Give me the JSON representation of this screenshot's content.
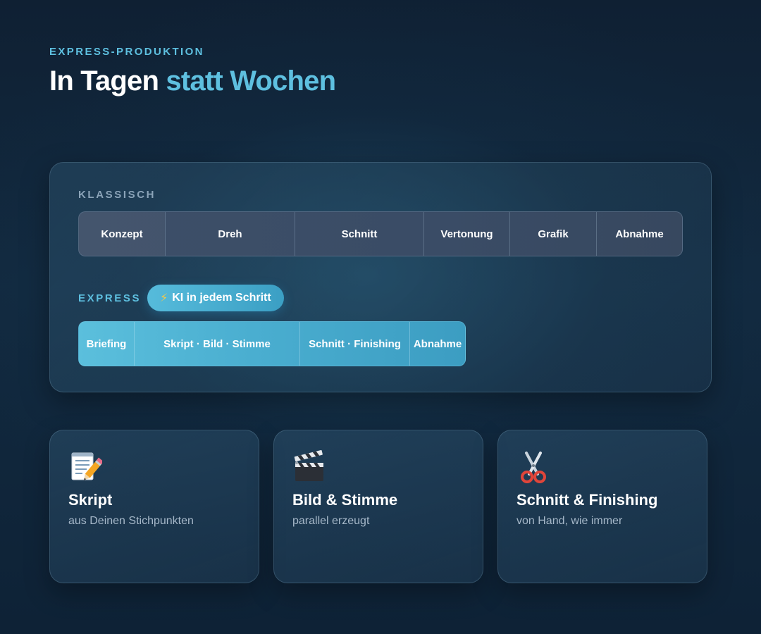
{
  "header": {
    "eyebrow": "EXPRESS-PRODUKTION",
    "title_main": "In Tagen",
    "title_accent": "statt Wochen"
  },
  "timeline": {
    "classic": {
      "label": "KLASSISCH",
      "segments": [
        "Konzept",
        "Dreh",
        "Schnitt",
        "Vertonung",
        "Grafik",
        "Abnahme"
      ]
    },
    "express": {
      "label": "EXPRESS",
      "badge": "KI in jedem Schritt",
      "badge_icon": "lightning-icon",
      "segments": [
        "Briefing",
        "Skript · Bild · Stimme",
        "Schnitt · Finishing",
        "Abnahme"
      ]
    }
  },
  "features": [
    {
      "icon": "memo-pencil-icon",
      "title": "Skript",
      "subtitle": "aus Deinen Stichpunkten"
    },
    {
      "icon": "clapperboard-icon",
      "title": "Bild & Stimme",
      "subtitle": "parallel erzeugt"
    },
    {
      "icon": "scissors-icon",
      "title": "Schnitt & Finishing",
      "subtitle": "von Hand, wie immer"
    }
  ],
  "colors": {
    "accent": "#5ec0e0",
    "background": "#122a40",
    "classic_track": "#3b4d66",
    "express_track": "#4aaed0"
  }
}
